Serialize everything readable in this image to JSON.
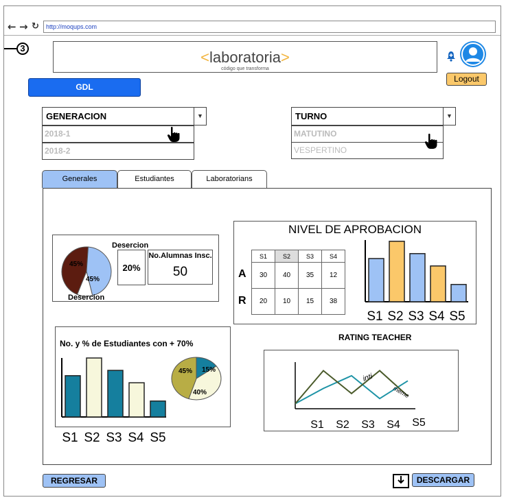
{
  "browser": {
    "url": "http://moqups.com"
  },
  "step": "3",
  "logo": {
    "open": "<",
    "name": "laboratoria",
    "close": ">",
    "tagline": "código que transforma"
  },
  "header": {
    "logout": "Logout",
    "region_button": "GDL"
  },
  "generacion": {
    "label": "GENERACION",
    "options": [
      "2018-1",
      "2018-2"
    ]
  },
  "turno": {
    "label": "TURNO",
    "options": [
      "MATUTINO",
      "VESPERTINO"
    ]
  },
  "tabs": [
    "Generales",
    "Estudiantes",
    "Laboratorians"
  ],
  "desercion": {
    "label_top": "Desercion",
    "label_bottom": "Desercion",
    "percent": "20%",
    "alumnas_label": "No.Alumnas Insc.",
    "alumnas_value": "50"
  },
  "aprobacion": {
    "title": "NIVEL DE APROBACION",
    "columns": [
      "S1",
      "S2",
      "S3",
      "S4"
    ],
    "rows": [
      {
        "label": "A",
        "values": [
          "30",
          "40",
          "35",
          "12"
        ]
      },
      {
        "label": "R",
        "values": [
          "20",
          "10",
          "15",
          "38"
        ]
      }
    ]
  },
  "estudiantes70": {
    "title": "No. y % de Estudiantes con + 70%"
  },
  "rating": {
    "title": "RATING TEACHER",
    "line1_label": "inti",
    "line2_label": "meme"
  },
  "footer": {
    "back": "REGRESAR",
    "download": "DESCARGAR"
  },
  "colors": {
    "blue_button": "#1a6cf0",
    "tab_active": "#9ec2f5",
    "yellow": "#fbc86a",
    "teal": "#157f9e",
    "olive": "#b8ad45",
    "cream": "#f7f7dc",
    "brown": "#5c1c10"
  },
  "chart_data": [
    {
      "type": "pie",
      "labels": [
        "45%",
        "45%",
        ""
      ],
      "values": [
        45,
        45,
        10
      ],
      "colors": [
        "#5c1c10",
        "#9ec2f5",
        "#ffffff"
      ]
    },
    {
      "type": "bar",
      "categories": [
        "S1",
        "S2",
        "S3",
        "S4",
        "S5"
      ],
      "values": [
        70,
        98,
        78,
        58,
        28
      ],
      "colors": [
        "#9ec2f5",
        "#fbc86a",
        "#9ec2f5",
        "#fbc86a",
        "#9ec2f5"
      ],
      "ylim": [
        0,
        100
      ]
    },
    {
      "type": "bar",
      "categories": [
        "S1",
        "S2",
        "S3",
        "S4",
        "S5"
      ],
      "values": [
        70,
        100,
        79,
        58,
        27
      ],
      "colors": [
        "#157f9e",
        "#f7f7dc",
        "#157f9e",
        "#f7f7dc",
        "#157f9e"
      ],
      "ylim": [
        0,
        100
      ]
    },
    {
      "type": "pie",
      "labels": [
        "15%",
        "40%",
        "45%"
      ],
      "values": [
        15,
        40,
        45
      ],
      "colors": [
        "#157f9e",
        "#f7f7dc",
        "#b8ad45"
      ]
    },
    {
      "type": "line",
      "categories": [
        "S1",
        "S2",
        "S3",
        "S4",
        "S5"
      ],
      "series": [
        {
          "name": "inti",
          "values": [
            10,
            40,
            65,
            20,
            55
          ]
        },
        {
          "name": "meme",
          "values": [
            10,
            75,
            30,
            75,
            25
          ]
        }
      ],
      "ylim": [
        0,
        100
      ]
    }
  ]
}
